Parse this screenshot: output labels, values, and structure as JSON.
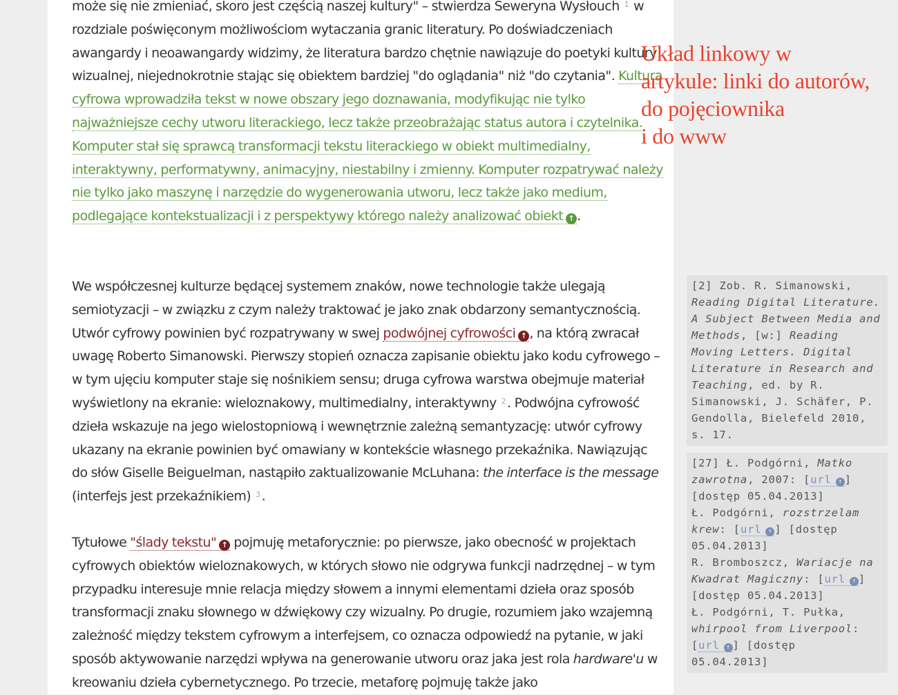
{
  "paragraph1": {
    "text_a": "może się nie zmieniać, skoro jest częścią naszej kultury\" – stwierdza Seweryna Wysłouch",
    "sup": "1",
    "text_b": "w rozdziale poświęconym możliwościom wytaczania granic literatury. Po doświadczeniach awangardy i neoawangardy widzimy, że literatura bardzo chętnie nawiązuje do poetyki kultury wizualnej, niejednokrotnie stając się obiektem bardziej \"do oglądania\" niż \"do czytania\".",
    "quote_link": "Kultura cyfrowa wprowadziła tekst w nowe obszary jego doznawania, modyfikując nie tylko najważniejsze cechy utworu literackiego, lecz także przeobrażając status autora i czytelnika. Komputer stał się sprawcą transformacji tekstu literackiego w obiekt multimedialny, interaktywny, performatywny, animacyjny, niestabilny i zmienny. Komputer rozpatrywać należy nie tylko jako maszynę i narzędzie do wygenerowania utworu, lecz także jako medium, podlegające kontekstualizacji i z perspektywy którego należy analizować obiekt",
    "end": "."
  },
  "paragraph2": {
    "text_a": "We współczesnej kulturze będącej systemem znaków, nowe technologie także ulegają semiotyzacji – w związku z czym należy traktować je jako znak obdarzony semantycznością. Utwór cyfrowy powinien być rozpatrywany w swej",
    "link": "podwójnej cyfrowości",
    "text_b": ", na którą zwracał uwagę Roberto Simanowski. Pierwszy stopień oznacza zapisanie obiektu jako kodu cyfrowego – w tym ujęciu komputer staje się nośnikiem sensu; druga cyfrowa warstwa obejmuje materiał wyświetlony na ekranie: wieloznakowy, multimedialny, interaktywny",
    "sup1": "2",
    "text_c": ". Podwójna cyfrowość dzieła wskazuje na jego wielostopniową i wewnętrznie zależną semantyzację: utwór cyfrowy ukazany na ekranie powinien być omawiany w kontekście własnego przekaźnika. Nawiązując do słów Giselle Beiguelman, nastąpiło zaktualizowanie McLuhana:",
    "italic": "the interface is the message",
    "text_d": "(interfejs jest przekaźnikiem)",
    "sup2": "3",
    "end": "."
  },
  "paragraph3": {
    "text_a": "Tytułowe",
    "link": "\"ślady tekstu\"",
    "text_b": "pojmuję metaforycznie: po pierwsze, jako obecność w projektach cyfrowych obiektów wieloznakowych, w których słowo nie odgrywa funkcji nadrzędnej – w tym przypadku interesuje mnie relacja między słowem a innymi elementami dzieła oraz sposób transformacji znaku słownego w dźwiękowy czy wizualny. Po drugie, rozumiem jako wzajemną zależność między tekstem cyfrowym a interfejsem, co oznacza odpowiedź na pytanie, w jaki sposób aktywowanie narzędzi wpływa na generowanie utworu oraz jaka jest rola",
    "italic": "hardware'u",
    "text_c": "w kreowaniu dzieła cybernetycznego. Po trzecie, metaforę pojmuję także jako"
  },
  "annotation": {
    "line1": "Układ linkowy w",
    "line2": "artykule: linki do autorów,",
    "line3": "do pojęciownika",
    "line4": "i do www"
  },
  "note2": {
    "l1": "[2] Zob. R. Simanowski,",
    "l2": "Reading Digital Literature.",
    "l3": "A Subject Between Media and",
    "l4a": "Methods",
    "l4b": ", [w:]",
    "l4c": "Reading",
    "l5": "Moving Letters. Digital",
    "l6": "Literature in Research and",
    "l7a": "Teaching",
    "l7b": ", ed. by R.",
    "l8": "Simanowski, J. Schäfer, P.",
    "l9": "Gendolla, Bielefeld 2010,",
    "l10": "s. 17."
  },
  "note27": {
    "l1a": "[27] Ł. Podgórni,",
    "l1b": "Matko",
    "l2a": "zawrotna",
    "l2b": ", 2007: [",
    "url": "url",
    "l2c": "]",
    "access": "[dostęp 05.04.2013]",
    "l4a": "Ł. Podgórni,",
    "l4b": "rozstrzelam",
    "l5a": "krew",
    "l5b": ": [",
    "l5c": "] [dostęp",
    "date": "05.04.2013]",
    "l7a": "R. Bromboszcz,",
    "l7b": "Wariacje na",
    "l8a": "Kwadrat Magiczny",
    "l8b": ": [",
    "l8c": "]",
    "l10": "Ł. Podgórni, T. Pułka,",
    "l11a": "whirpool from Liverpool",
    "l11b": ":",
    "l12a": "[",
    "l12b": "] [dostęp"
  },
  "icons": {
    "link_icon": "arrow-up-circle-icon",
    "glyph": "↑"
  },
  "colors": {
    "quote_link": "#5a9a3c",
    "term_link": "#8b2a2a",
    "annotation": "#e8432e",
    "url": "#7a8fb5"
  }
}
